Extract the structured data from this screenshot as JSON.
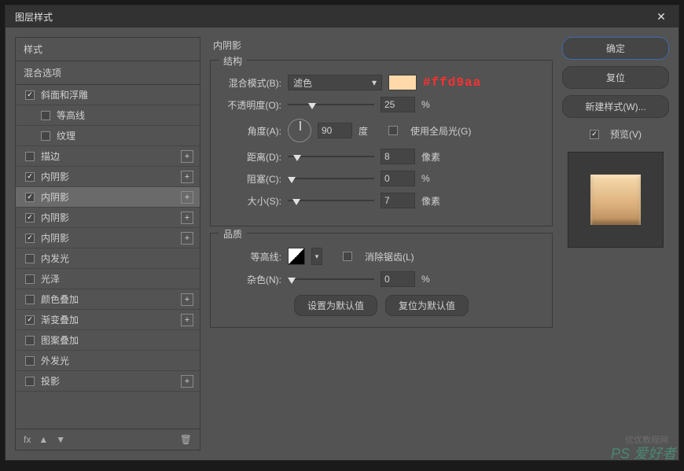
{
  "title": "图层样式",
  "left": {
    "styles_header": "样式",
    "blend_header": "混合选项",
    "items": [
      {
        "label": "斜面和浮雕",
        "checked": true,
        "indent": false,
        "selected": false,
        "add": false
      },
      {
        "label": "等高线",
        "checked": false,
        "indent": true,
        "selected": false,
        "add": false
      },
      {
        "label": "纹理",
        "checked": false,
        "indent": true,
        "selected": false,
        "add": false
      },
      {
        "label": "描边",
        "checked": false,
        "indent": false,
        "selected": false,
        "add": true
      },
      {
        "label": "内阴影",
        "checked": true,
        "indent": false,
        "selected": false,
        "add": true
      },
      {
        "label": "内阴影",
        "checked": true,
        "indent": false,
        "selected": true,
        "add": true
      },
      {
        "label": "内阴影",
        "checked": true,
        "indent": false,
        "selected": false,
        "add": true
      },
      {
        "label": "内阴影",
        "checked": true,
        "indent": false,
        "selected": false,
        "add": true
      },
      {
        "label": "内发光",
        "checked": false,
        "indent": false,
        "selected": false,
        "add": false
      },
      {
        "label": "光泽",
        "checked": false,
        "indent": false,
        "selected": false,
        "add": false
      },
      {
        "label": "颜色叠加",
        "checked": false,
        "indent": false,
        "selected": false,
        "add": true
      },
      {
        "label": "渐变叠加",
        "checked": true,
        "indent": false,
        "selected": false,
        "add": true
      },
      {
        "label": "图案叠加",
        "checked": false,
        "indent": false,
        "selected": false,
        "add": false
      },
      {
        "label": "外发光",
        "checked": false,
        "indent": false,
        "selected": false,
        "add": false
      },
      {
        "label": "投影",
        "checked": false,
        "indent": false,
        "selected": false,
        "add": true
      }
    ],
    "footer_fx": "fx",
    "footer_trash": "🗑"
  },
  "center": {
    "title": "内阴影",
    "structure": {
      "legend": "结构",
      "blend_mode_label": "混合模式(B):",
      "blend_mode_value": "滤色",
      "color_hex": "#ffd9aa",
      "opacity_label": "不透明度(O):",
      "opacity_value": "25",
      "opacity_unit": "%",
      "angle_label": "角度(A):",
      "angle_value": "90",
      "angle_unit": "度",
      "global_light_label": "使用全局光(G)",
      "distance_label": "距离(D):",
      "distance_value": "8",
      "distance_unit": "像素",
      "choke_label": "阻塞(C):",
      "choke_value": "0",
      "choke_unit": "%",
      "size_label": "大小(S):",
      "size_value": "7",
      "size_unit": "像素"
    },
    "quality": {
      "legend": "品质",
      "contour_label": "等高线:",
      "antialias_label": "消除锯齿(L)",
      "noise_label": "杂色(N):",
      "noise_value": "0",
      "noise_unit": "%"
    },
    "reset_default": "设置为默认值",
    "restore_default": "复位为默认值"
  },
  "right": {
    "ok": "确定",
    "cancel": "复位",
    "new_style": "新建样式(W)...",
    "preview_label": "预览(V)"
  },
  "watermark": "PS 爱好者",
  "watermark2": "优优教程网"
}
